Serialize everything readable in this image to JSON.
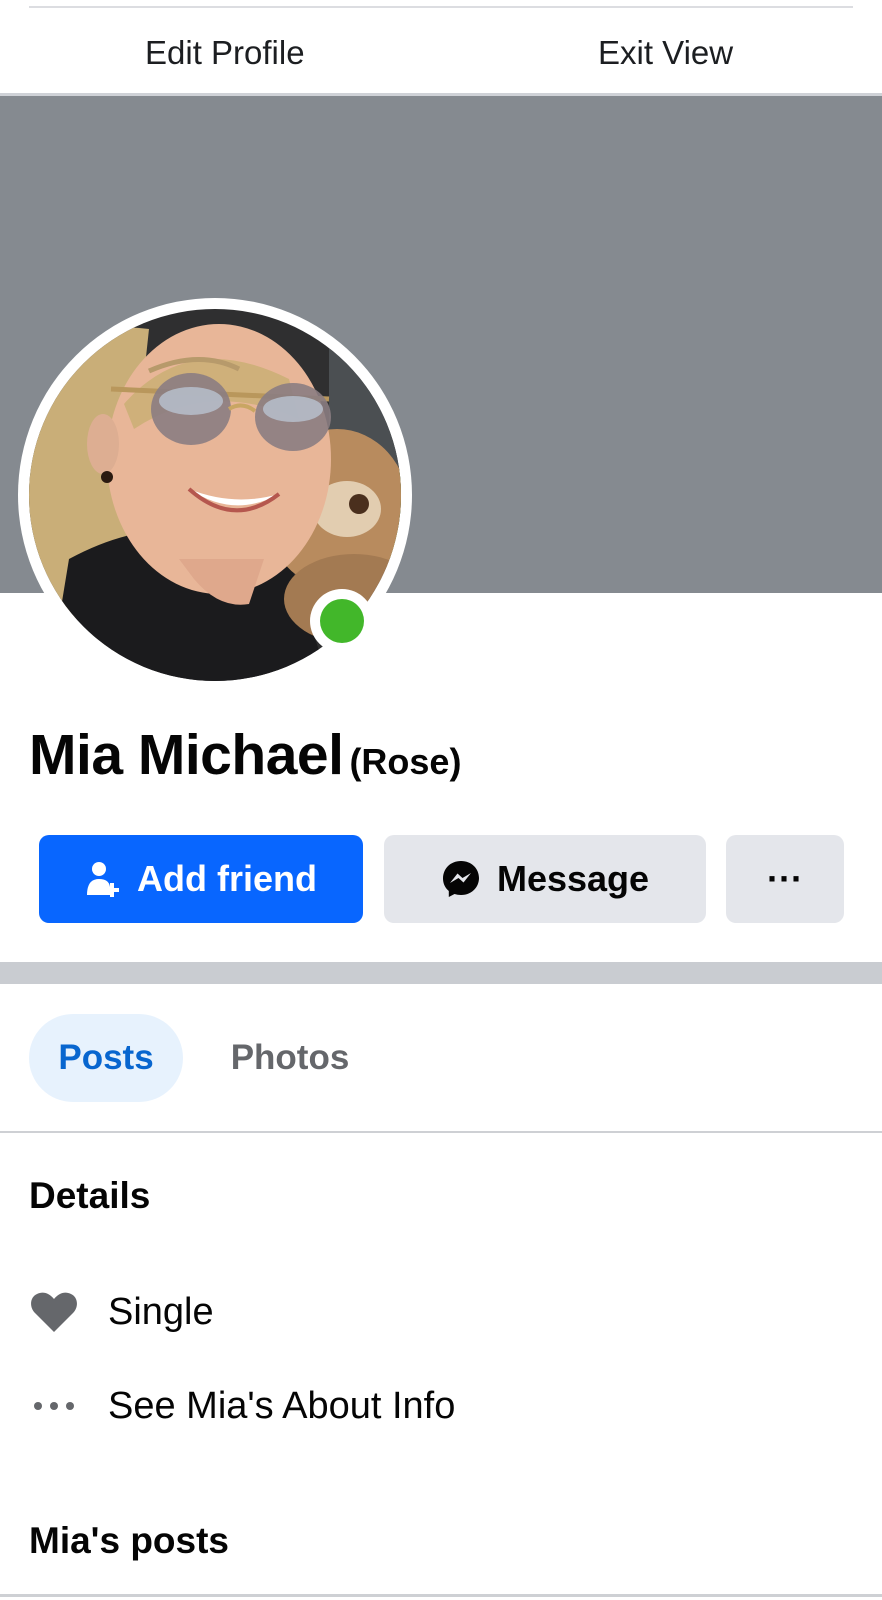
{
  "topbar": {
    "edit_profile": "Edit Profile",
    "exit_view": "Exit View"
  },
  "profile": {
    "name": "Mia Michael",
    "alternate_name": "(Rose)",
    "online": true,
    "status_color": "#42b72a"
  },
  "actions": {
    "add_friend": "Add friend",
    "message": "Message",
    "more": "···"
  },
  "tabs": [
    {
      "label": "Posts",
      "active": true
    },
    {
      "label": "Photos",
      "active": false
    }
  ],
  "details": {
    "title": "Details",
    "items": [
      {
        "icon": "heart-icon",
        "text": "Single"
      },
      {
        "icon": "more-dots-icon",
        "text": "See Mia's About Info"
      }
    ]
  },
  "posts_section": {
    "title": "Mia's posts"
  },
  "colors": {
    "primary": "#0866ff",
    "cover": "#858a90",
    "secondary_button": "#e4e6eb",
    "active_tab_bg": "#e7f2fd",
    "active_tab_text": "#0866cf"
  }
}
